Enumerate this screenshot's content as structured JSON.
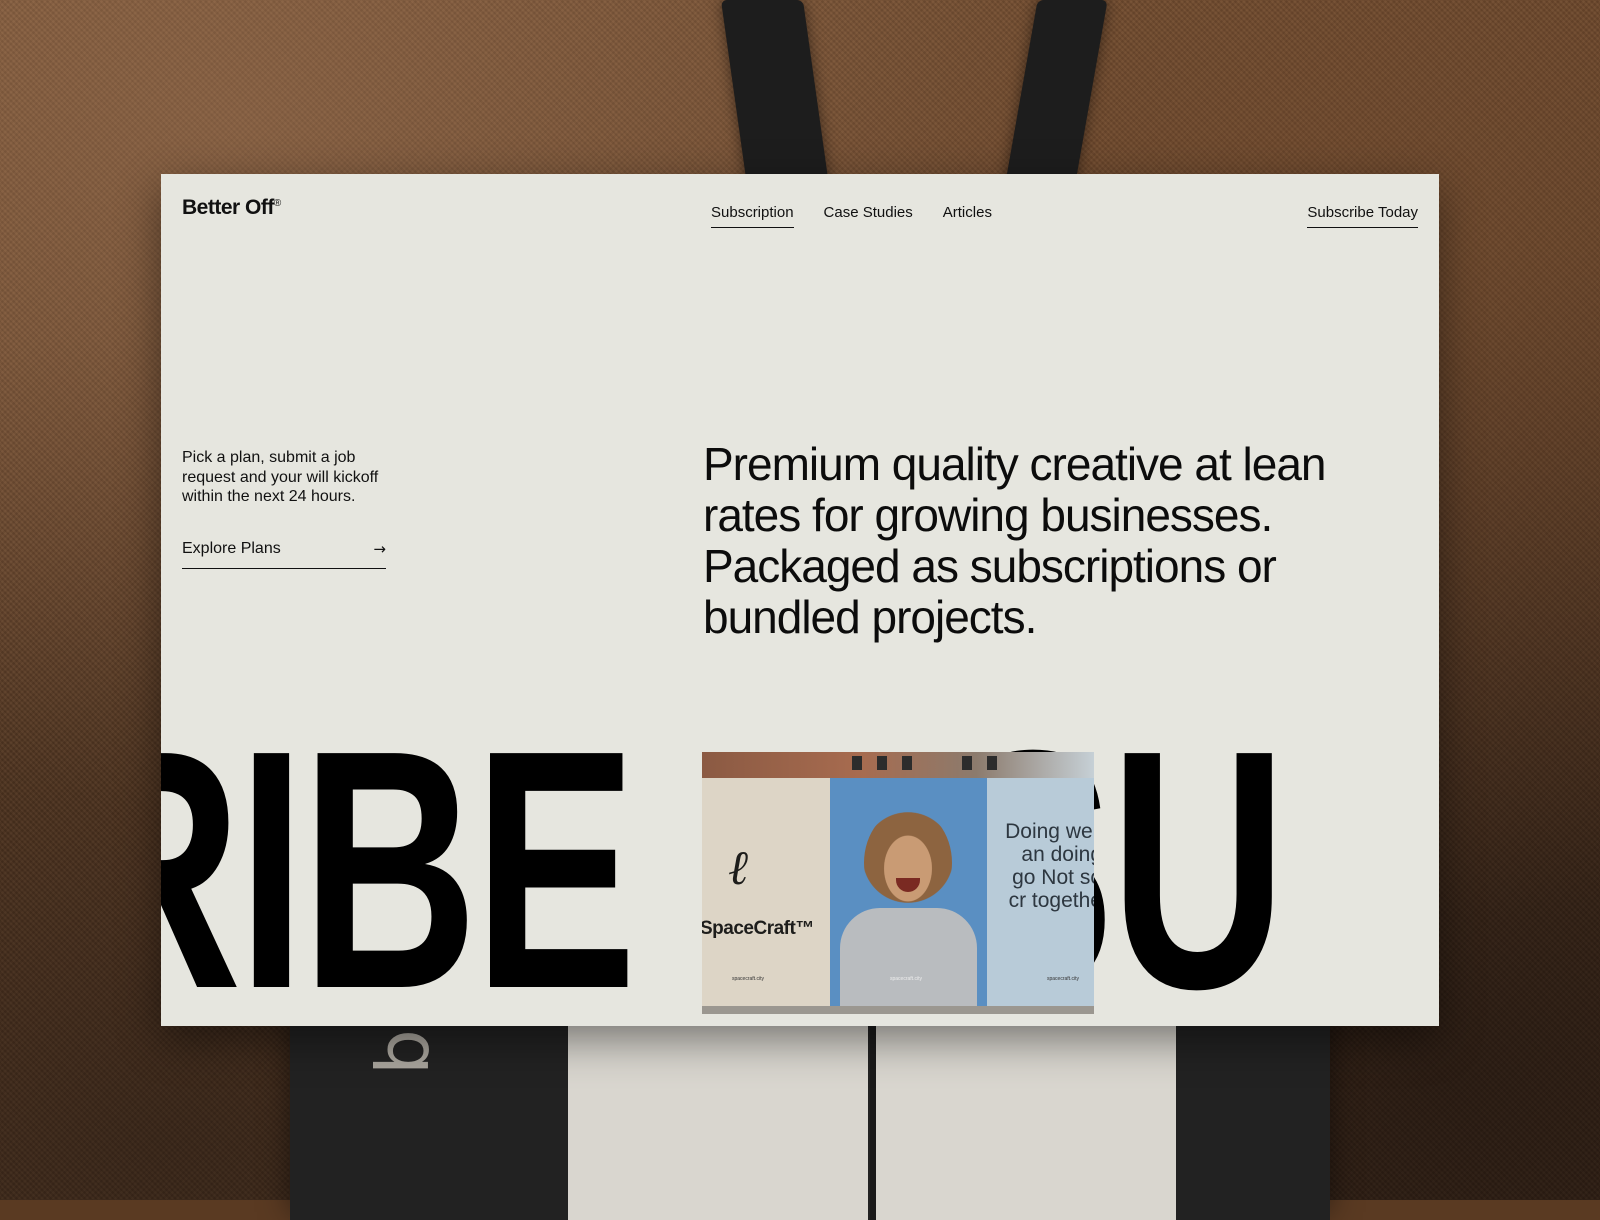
{
  "brand": {
    "name": "Better Off",
    "mark": "®"
  },
  "nav": {
    "items": [
      {
        "label": "Subscription",
        "active": true
      },
      {
        "label": "Case Studies",
        "active": false
      },
      {
        "label": "Articles",
        "active": false
      }
    ],
    "cta_label": "Subscribe Today"
  },
  "intro": {
    "text": "Pick a plan, submit a job request and your will kickoff within the next 24 hours.",
    "link_label": "Explore Plans",
    "link_icon": "arrow-right-icon"
  },
  "headline": "Premium quality creative at lean rates for growing businesses. Packaged as subscriptions or bundled projects.",
  "marquee": {
    "left_text": "RIBE",
    "right_text": "SU"
  },
  "billboard": {
    "brand_name": "SpaceCraft™",
    "url_text": "spacecraft.city",
    "quote": "Doing well an doing go Not so cr togethe"
  },
  "colors": {
    "page_bg": "#e6e6df",
    "text": "#111111",
    "backdrop": "#5a3a22"
  }
}
